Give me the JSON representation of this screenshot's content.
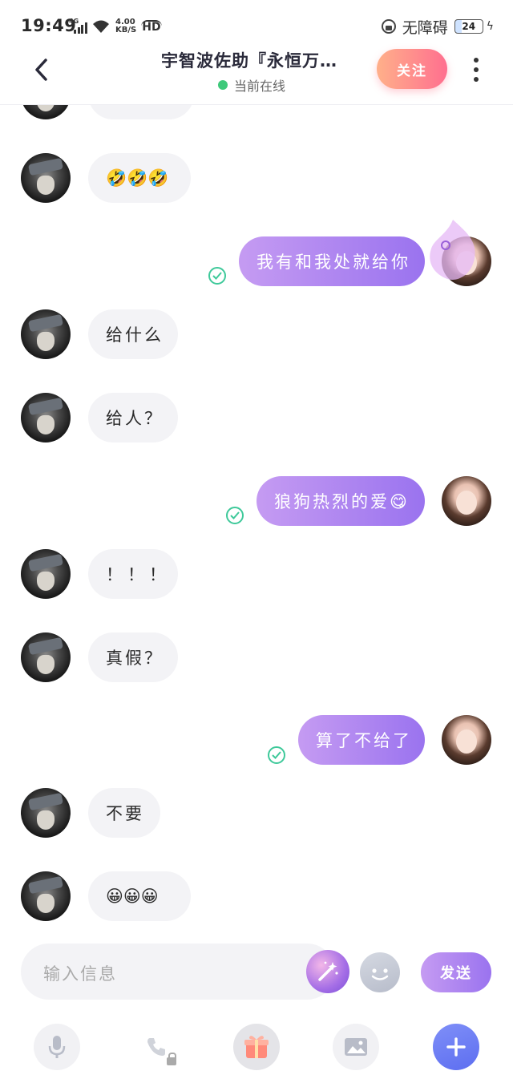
{
  "status_bar": {
    "time": "19:49",
    "network": "4G",
    "speed_value": "4.00",
    "speed_unit": "KB/S",
    "hd_label": "HD",
    "accessibility_label": "无障碍",
    "battery_level": "24"
  },
  "header": {
    "title": "宇智波佐助『永恒万…",
    "online_status": "当前在线",
    "follow_label": "关注"
  },
  "messages": [
    {
      "side": "in",
      "text": "🤣🤣🤣"
    },
    {
      "side": "out",
      "text": "我有和我处就给你",
      "read": true
    },
    {
      "side": "in",
      "text": "给什么"
    },
    {
      "side": "in",
      "text": "给人？"
    },
    {
      "side": "out",
      "text": "狼狗热烈的爱😋",
      "read": true
    },
    {
      "side": "in",
      "text": "！！！"
    },
    {
      "side": "in",
      "text": "真假？"
    },
    {
      "side": "out",
      "text": "算了不给了",
      "read": true
    },
    {
      "side": "in",
      "text": "不要"
    },
    {
      "side": "in",
      "text": "😀😀😀"
    }
  ],
  "composer": {
    "placeholder": "输入信息",
    "send_label": "发送"
  },
  "toolbar": {
    "icons": [
      "microphone-icon",
      "phone-icon",
      "gift-icon",
      "image-icon",
      "plus-icon"
    ]
  },
  "colors": {
    "accent_purple": "#9a73ef",
    "follow_gradient_start": "#ffb08a",
    "follow_gradient_end": "#ff6f8f",
    "online_green": "#3ec97a",
    "read_check_green": "#3ec99a"
  }
}
